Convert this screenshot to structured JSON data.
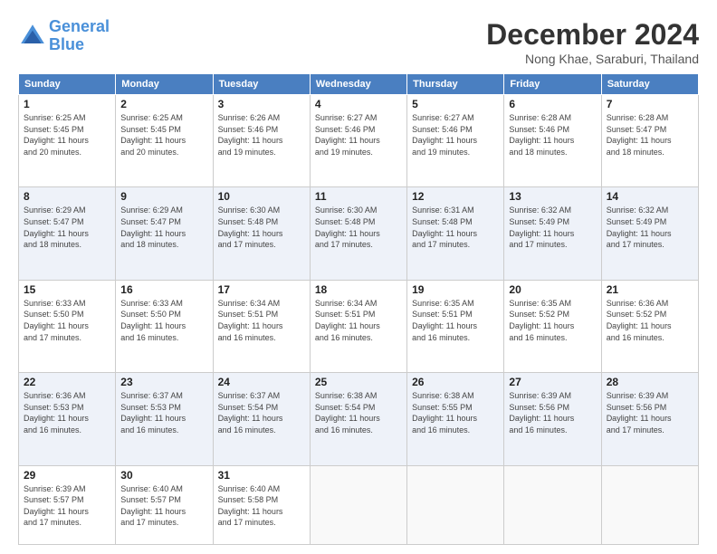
{
  "header": {
    "logo_line1": "General",
    "logo_line2": "Blue",
    "month": "December 2024",
    "location": "Nong Khae, Saraburi, Thailand"
  },
  "weekdays": [
    "Sunday",
    "Monday",
    "Tuesday",
    "Wednesday",
    "Thursday",
    "Friday",
    "Saturday"
  ],
  "weeks": [
    [
      {
        "day": "1",
        "info": "Sunrise: 6:25 AM\nSunset: 5:45 PM\nDaylight: 11 hours\nand 20 minutes."
      },
      {
        "day": "2",
        "info": "Sunrise: 6:25 AM\nSunset: 5:45 PM\nDaylight: 11 hours\nand 20 minutes."
      },
      {
        "day": "3",
        "info": "Sunrise: 6:26 AM\nSunset: 5:46 PM\nDaylight: 11 hours\nand 19 minutes."
      },
      {
        "day": "4",
        "info": "Sunrise: 6:27 AM\nSunset: 5:46 PM\nDaylight: 11 hours\nand 19 minutes."
      },
      {
        "day": "5",
        "info": "Sunrise: 6:27 AM\nSunset: 5:46 PM\nDaylight: 11 hours\nand 19 minutes."
      },
      {
        "day": "6",
        "info": "Sunrise: 6:28 AM\nSunset: 5:46 PM\nDaylight: 11 hours\nand 18 minutes."
      },
      {
        "day": "7",
        "info": "Sunrise: 6:28 AM\nSunset: 5:47 PM\nDaylight: 11 hours\nand 18 minutes."
      }
    ],
    [
      {
        "day": "8",
        "info": "Sunrise: 6:29 AM\nSunset: 5:47 PM\nDaylight: 11 hours\nand 18 minutes."
      },
      {
        "day": "9",
        "info": "Sunrise: 6:29 AM\nSunset: 5:47 PM\nDaylight: 11 hours\nand 18 minutes."
      },
      {
        "day": "10",
        "info": "Sunrise: 6:30 AM\nSunset: 5:48 PM\nDaylight: 11 hours\nand 17 minutes."
      },
      {
        "day": "11",
        "info": "Sunrise: 6:30 AM\nSunset: 5:48 PM\nDaylight: 11 hours\nand 17 minutes."
      },
      {
        "day": "12",
        "info": "Sunrise: 6:31 AM\nSunset: 5:48 PM\nDaylight: 11 hours\nand 17 minutes."
      },
      {
        "day": "13",
        "info": "Sunrise: 6:32 AM\nSunset: 5:49 PM\nDaylight: 11 hours\nand 17 minutes."
      },
      {
        "day": "14",
        "info": "Sunrise: 6:32 AM\nSunset: 5:49 PM\nDaylight: 11 hours\nand 17 minutes."
      }
    ],
    [
      {
        "day": "15",
        "info": "Sunrise: 6:33 AM\nSunset: 5:50 PM\nDaylight: 11 hours\nand 17 minutes."
      },
      {
        "day": "16",
        "info": "Sunrise: 6:33 AM\nSunset: 5:50 PM\nDaylight: 11 hours\nand 16 minutes."
      },
      {
        "day": "17",
        "info": "Sunrise: 6:34 AM\nSunset: 5:51 PM\nDaylight: 11 hours\nand 16 minutes."
      },
      {
        "day": "18",
        "info": "Sunrise: 6:34 AM\nSunset: 5:51 PM\nDaylight: 11 hours\nand 16 minutes."
      },
      {
        "day": "19",
        "info": "Sunrise: 6:35 AM\nSunset: 5:51 PM\nDaylight: 11 hours\nand 16 minutes."
      },
      {
        "day": "20",
        "info": "Sunrise: 6:35 AM\nSunset: 5:52 PM\nDaylight: 11 hours\nand 16 minutes."
      },
      {
        "day": "21",
        "info": "Sunrise: 6:36 AM\nSunset: 5:52 PM\nDaylight: 11 hours\nand 16 minutes."
      }
    ],
    [
      {
        "day": "22",
        "info": "Sunrise: 6:36 AM\nSunset: 5:53 PM\nDaylight: 11 hours\nand 16 minutes."
      },
      {
        "day": "23",
        "info": "Sunrise: 6:37 AM\nSunset: 5:53 PM\nDaylight: 11 hours\nand 16 minutes."
      },
      {
        "day": "24",
        "info": "Sunrise: 6:37 AM\nSunset: 5:54 PM\nDaylight: 11 hours\nand 16 minutes."
      },
      {
        "day": "25",
        "info": "Sunrise: 6:38 AM\nSunset: 5:54 PM\nDaylight: 11 hours\nand 16 minutes."
      },
      {
        "day": "26",
        "info": "Sunrise: 6:38 AM\nSunset: 5:55 PM\nDaylight: 11 hours\nand 16 minutes."
      },
      {
        "day": "27",
        "info": "Sunrise: 6:39 AM\nSunset: 5:56 PM\nDaylight: 11 hours\nand 16 minutes."
      },
      {
        "day": "28",
        "info": "Sunrise: 6:39 AM\nSunset: 5:56 PM\nDaylight: 11 hours\nand 17 minutes."
      }
    ],
    [
      {
        "day": "29",
        "info": "Sunrise: 6:39 AM\nSunset: 5:57 PM\nDaylight: 11 hours\nand 17 minutes."
      },
      {
        "day": "30",
        "info": "Sunrise: 6:40 AM\nSunset: 5:57 PM\nDaylight: 11 hours\nand 17 minutes."
      },
      {
        "day": "31",
        "info": "Sunrise: 6:40 AM\nSunset: 5:58 PM\nDaylight: 11 hours\nand 17 minutes."
      },
      {
        "day": "",
        "info": ""
      },
      {
        "day": "",
        "info": ""
      },
      {
        "day": "",
        "info": ""
      },
      {
        "day": "",
        "info": ""
      }
    ]
  ]
}
